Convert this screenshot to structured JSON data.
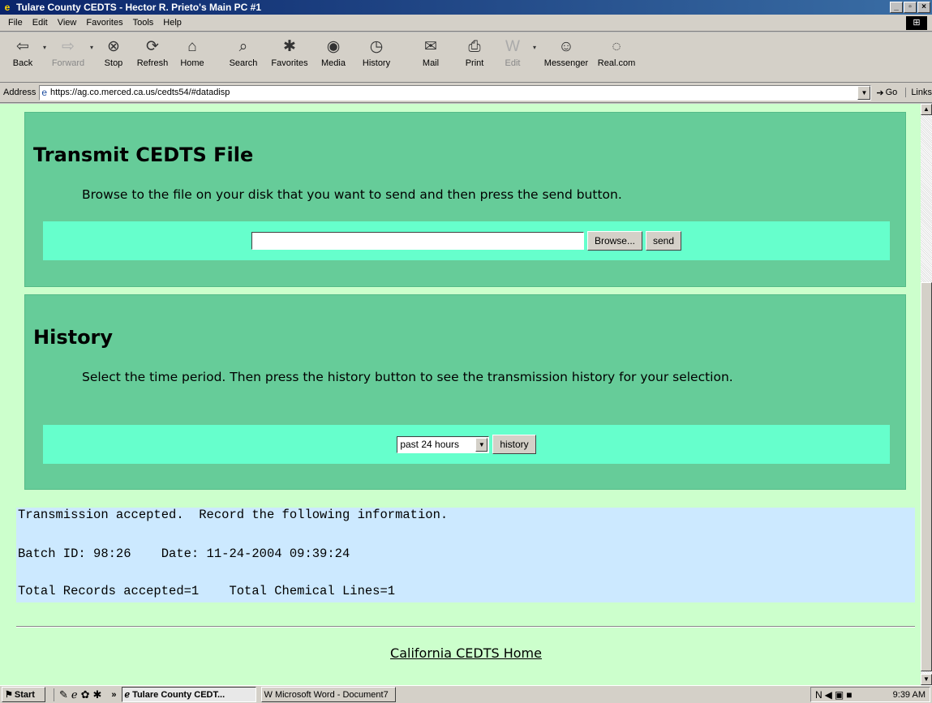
{
  "window": {
    "title": "Tulare County CEDTS - Hector R. Prieto's Main PC #1",
    "controls": [
      "_",
      "▫",
      "×"
    ]
  },
  "menu": [
    "File",
    "Edit",
    "View",
    "Favorites",
    "Tools",
    "Help"
  ],
  "toolbar": {
    "back": "Back",
    "forward": "Forward",
    "stop": "Stop",
    "refresh": "Refresh",
    "home": "Home",
    "search": "Search",
    "favorites": "Favorites",
    "media": "Media",
    "history": "History",
    "mail": "Mail",
    "print": "Print",
    "edit": "Edit",
    "messenger": "Messenger",
    "realcom": "Real.com"
  },
  "address": {
    "label": "Address",
    "url": "https://ag.co.merced.ca.us/cedts54/#datadisp",
    "go": "Go",
    "links": "Links"
  },
  "transmit": {
    "heading": "Transmit CEDTS File",
    "instructions": "Browse to the file on your disk that you want to send and then press the send button.",
    "file_value": "",
    "browse_label": "Browse...",
    "send_label": "send"
  },
  "history": {
    "heading": "History",
    "instructions": "Select the time period. Then press the history button to see the transmission history for your selection.",
    "period_selected": "past 24 hours",
    "button_label": "history"
  },
  "result": {
    "line1": "Transmission accepted.  Record the following information.",
    "line2": "Batch ID: 98:26    Date: 11-24-2004 09:39:24",
    "line3": "Total Records accepted=1    Total Chemical Lines=1"
  },
  "footer": {
    "home_link": "California CEDTS Home"
  },
  "taskbar": {
    "start": "Start",
    "items": [
      "Tulare County CEDT...",
      "Microsoft Word - Document7"
    ],
    "clock": "9:39 AM"
  }
}
